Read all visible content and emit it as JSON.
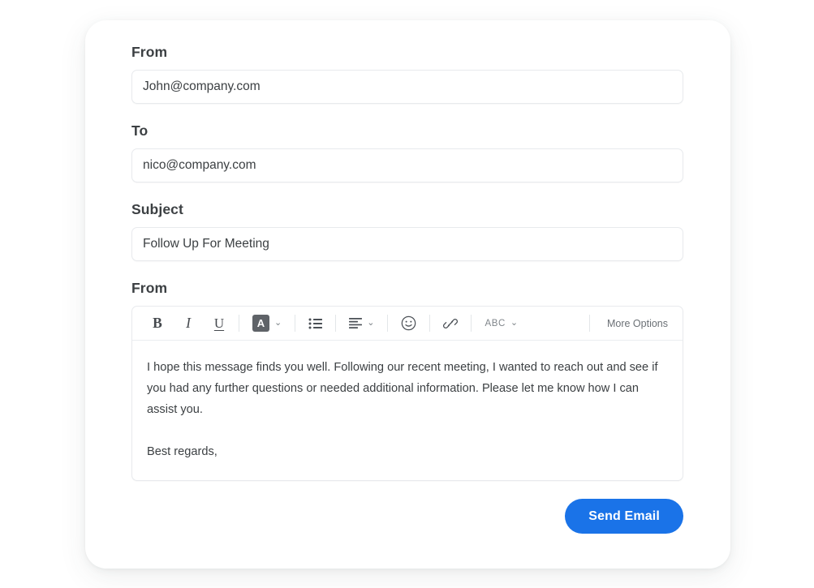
{
  "card": {
    "fields": [
      {
        "label": "From",
        "value": "John@company.com",
        "placeholder": "From",
        "name": "from"
      },
      {
        "label": "To",
        "value": "nico@company.com",
        "placeholder": "To",
        "name": "to"
      },
      {
        "label": "Subject",
        "value": "Follow Up For Meeting",
        "placeholder": "Subject",
        "name": "subject"
      }
    ],
    "body_label": "From",
    "editor": {
      "toolbar": {
        "bold_label": "B",
        "italic_label": "I",
        "underline_label": "U",
        "text_color_label": "A",
        "chevron": "⌄",
        "spellcheck_label": "ABC",
        "more_options_label": "More Options",
        "icons": [
          "bold-icon",
          "italic-icon",
          "underline-icon",
          "text-color-icon",
          "bulleted-list-icon",
          "align-left-icon",
          "emoji-icon",
          "link-icon",
          "spellcheck-icon"
        ]
      },
      "body": {
        "paragraph": "I hope this message finds you well. Following our recent meeting, I wanted to reach out and see if you had any further questions or needed additional information. Please let me know how I can assist you.",
        "signature": "Best regards,"
      }
    },
    "send_button_label": "Send Email"
  },
  "colors": {
    "accent": "#1a73e8",
    "label_text": "#3c4043",
    "body_text": "#3c4043",
    "border": "#e8eaed",
    "toolbar_icon": "#4a4f55",
    "muted_text": "#80868b",
    "color_swatch": "#5f6368",
    "page_background": "#ffffff",
    "card_background": "#ffffff"
  }
}
